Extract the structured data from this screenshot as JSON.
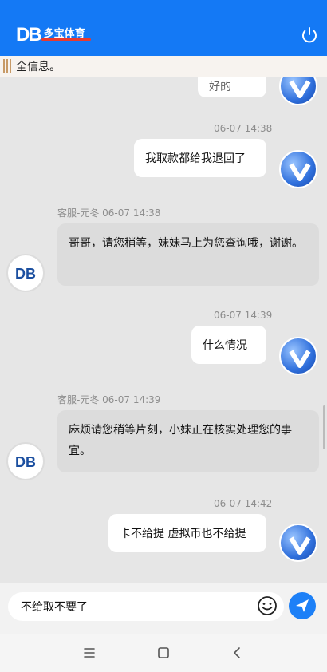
{
  "header": {
    "logo_mark": "DB",
    "logo_text": "多宝体育",
    "power_icon": "power-icon"
  },
  "notice": {
    "text": "全信息。"
  },
  "messages": [
    {
      "from": "user",
      "text": "好的"
    },
    {
      "from": "user",
      "time": "06-07 14:38",
      "text": "我取款都给我退回了"
    },
    {
      "from": "agent",
      "meta": "客服-元冬  06-07 14:38",
      "text": "哥哥，请您稍等，妹妹马上为您查询哦，谢谢。"
    },
    {
      "from": "user",
      "time": "06-07 14:39",
      "text": "什么情况"
    },
    {
      "from": "agent",
      "meta": "客服-元冬  06-07 14:39",
      "text": "麻烦请您稍等片刻，小妹正在核实处理您的事宜。"
    },
    {
      "from": "user",
      "time": "06-07 14:42",
      "text": "卡不给提 虚拟币也不给提"
    }
  ],
  "composer": {
    "value": "不给取不要了",
    "emoji_icon": "emoji-icon",
    "send_icon": "send-icon"
  },
  "navbar": {
    "icons": [
      "menu-icon",
      "home-square-icon",
      "back-icon"
    ]
  },
  "colors": {
    "header_bg": "#1479f5",
    "send_button": "#1d80f7"
  }
}
